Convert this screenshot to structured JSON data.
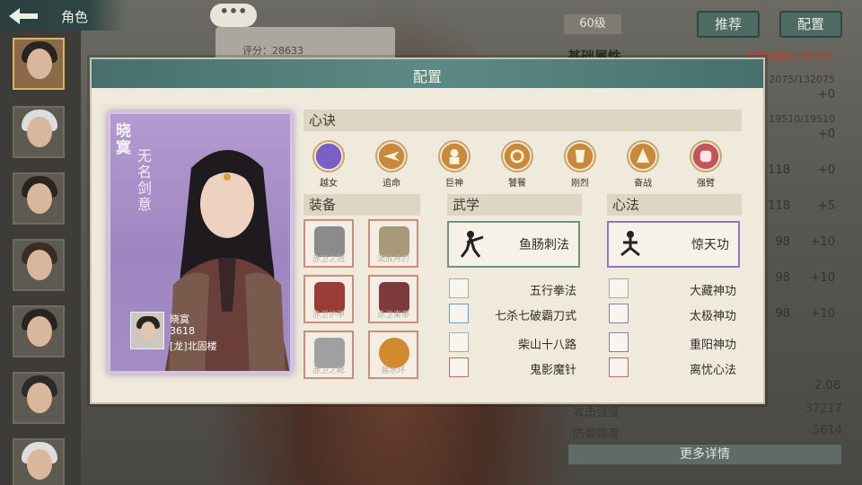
{
  "header": {
    "back_icon": "arrow-left-icon",
    "title": "角色"
  },
  "background": {
    "bubble": "•••",
    "score": "评分：28633"
  },
  "right_panel": {
    "level": "60级",
    "recommend": "推荐",
    "config": "配置",
    "basic_title": "基础属性",
    "title_tag": "宛若绝后(28633)",
    "hp": "2075/132075",
    "hp_sub": "+0",
    "mp": "19510/19510",
    "mp_sub": "+0",
    "rows": [
      {
        "value": "118",
        "plus": "+0"
      },
      {
        "value": "118",
        "plus": "+5"
      },
      {
        "value": "98",
        "plus": "+10"
      },
      {
        "value": "98",
        "plus": "+10"
      },
      {
        "value": "98",
        "plus": "+10"
      }
    ],
    "crit_value": "2.08",
    "attack_label": "攻击强度",
    "attack_value": "37217",
    "defense_label": "防御强度",
    "defense_value": "5614",
    "more": "更多详情"
  },
  "dialog": {
    "title": "配置",
    "character": {
      "name": "晓寞",
      "subtitle": "无名剑意",
      "info_name": "晓寞",
      "info_score": "3618",
      "info_guild": "[龙]北固楼"
    },
    "xinjue_title": "心诀",
    "xinjue": [
      {
        "label": "越女",
        "icon": "crescent-icon",
        "color": "#7a5fc4"
      },
      {
        "label": "追命",
        "icon": "dash-icon",
        "color": "#c88a3a"
      },
      {
        "label": "巨神",
        "icon": "giant-icon",
        "color": "#c88a3a"
      },
      {
        "label": "饕餮",
        "icon": "beast-icon",
        "color": "#c88a3a"
      },
      {
        "label": "刚烈",
        "icon": "fury-icon",
        "color": "#c88a3a"
      },
      {
        "label": "奋战",
        "icon": "battle-icon",
        "color": "#c88a3a"
      },
      {
        "label": "强臂",
        "icon": "fist-icon",
        "color": "#c2545a"
      }
    ],
    "equip_title": "装备",
    "equipment": [
      {
        "label": "赤卫之冠",
        "icon": "helmet-icon",
        "color": "#8b8b8b"
      },
      {
        "label": "流放月刃",
        "icon": "blade-icon",
        "color": "#a89a78"
      },
      {
        "label": "赤卫护甲",
        "icon": "armor-icon",
        "color": "#9b3b35"
      },
      {
        "label": "赤卫束带",
        "icon": "belt-icon",
        "color": "#7e3b3b"
      },
      {
        "label": "赤卫之靴",
        "icon": "boots-icon",
        "color": "#a0a0a0"
      },
      {
        "label": "易水环",
        "icon": "ring-icon",
        "color": "#d18a2f"
      }
    ],
    "martial_title": "武学",
    "martial_main": "鱼肠刺法",
    "martial": [
      "五行拳法",
      "七杀七破霸刀式",
      "柴山十八路",
      "鬼影魔针"
    ],
    "inner_title": "心法",
    "inner_main": "惊天功",
    "inner": [
      "大藏神功",
      "太极神功",
      "重阳神功",
      "离忧心法"
    ]
  }
}
